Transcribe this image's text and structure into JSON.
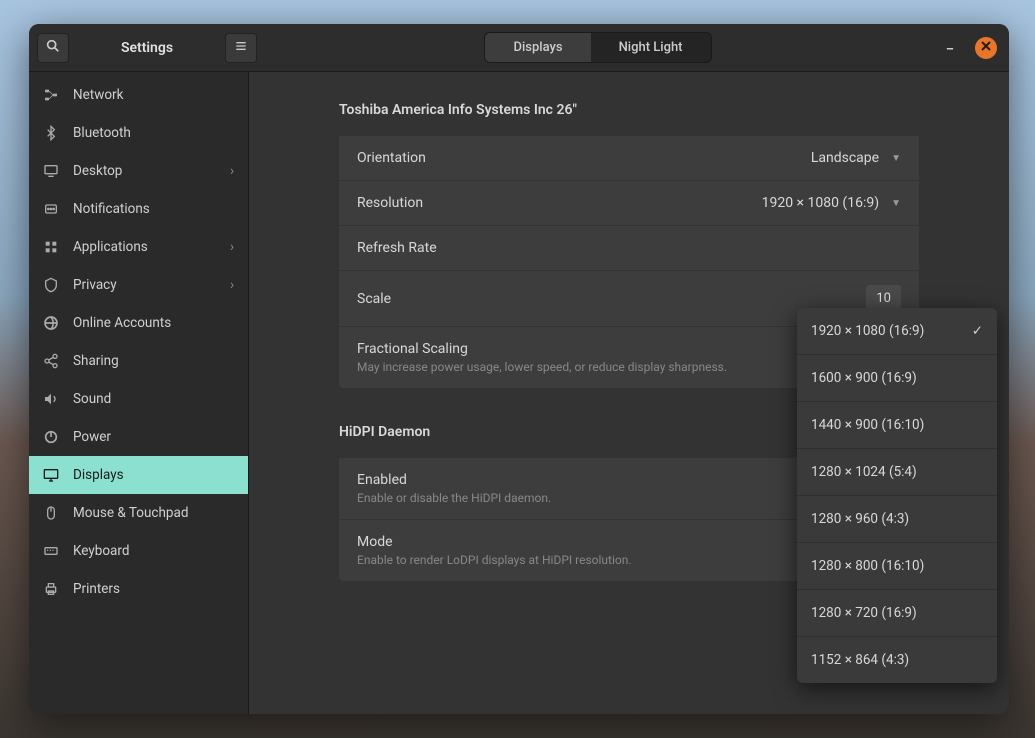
{
  "header": {
    "title": "Settings",
    "tabs": [
      {
        "label": "Displays",
        "active": true
      },
      {
        "label": "Night Light",
        "active": false
      }
    ]
  },
  "sidebar": {
    "items": [
      {
        "id": "network",
        "label": "Network",
        "chevron": false
      },
      {
        "id": "bluetooth",
        "label": "Bluetooth",
        "chevron": false
      },
      {
        "id": "desktop",
        "label": "Desktop",
        "chevron": true
      },
      {
        "id": "notifications",
        "label": "Notifications",
        "chevron": false
      },
      {
        "id": "applications",
        "label": "Applications",
        "chevron": true
      },
      {
        "id": "privacy",
        "label": "Privacy",
        "chevron": true
      },
      {
        "id": "online-accounts",
        "label": "Online Accounts",
        "chevron": false
      },
      {
        "id": "sharing",
        "label": "Sharing",
        "chevron": false
      },
      {
        "id": "sound",
        "label": "Sound",
        "chevron": false
      },
      {
        "id": "power",
        "label": "Power",
        "chevron": false
      },
      {
        "id": "displays",
        "label": "Displays",
        "chevron": false,
        "active": true
      },
      {
        "id": "mouse-touchpad",
        "label": "Mouse & Touchpad",
        "chevron": false
      },
      {
        "id": "keyboard",
        "label": "Keyboard",
        "chevron": false
      },
      {
        "id": "printers",
        "label": "Printers",
        "chevron": false
      }
    ]
  },
  "main": {
    "display_name": "Toshiba America Info Systems Inc 26\"",
    "orientation": {
      "label": "Orientation",
      "value": "Landscape"
    },
    "resolution": {
      "label": "Resolution",
      "value": "1920 × 1080 (16:9)"
    },
    "refresh_rate": {
      "label": "Refresh Rate"
    },
    "scale": {
      "label": "Scale",
      "visible_value": "10"
    },
    "fractional_scaling": {
      "label": "Fractional Scaling",
      "sub": "May increase power usage, lower speed, or reduce display sharpness."
    },
    "hidpi": {
      "title": "HiDPI Daemon",
      "enabled": {
        "label": "Enabled",
        "sub": "Enable or disable the HiDPI daemon."
      },
      "mode": {
        "label": "Mode",
        "sub": "Enable to render LoDPI displays at HiDPI resolution."
      }
    }
  },
  "dropdown": {
    "options": [
      {
        "label": "1920 × 1080 (16:9)",
        "selected": true
      },
      {
        "label": "1600 × 900 (16:9)"
      },
      {
        "label": "1440 × 900 (16:10)"
      },
      {
        "label": "1280 × 1024 (5:4)"
      },
      {
        "label": "1280 × 960 (4:3)"
      },
      {
        "label": "1280 × 800 (16:10)"
      },
      {
        "label": "1280 × 720 (16:9)"
      },
      {
        "label": "1152 × 864 (4:3)"
      }
    ]
  }
}
